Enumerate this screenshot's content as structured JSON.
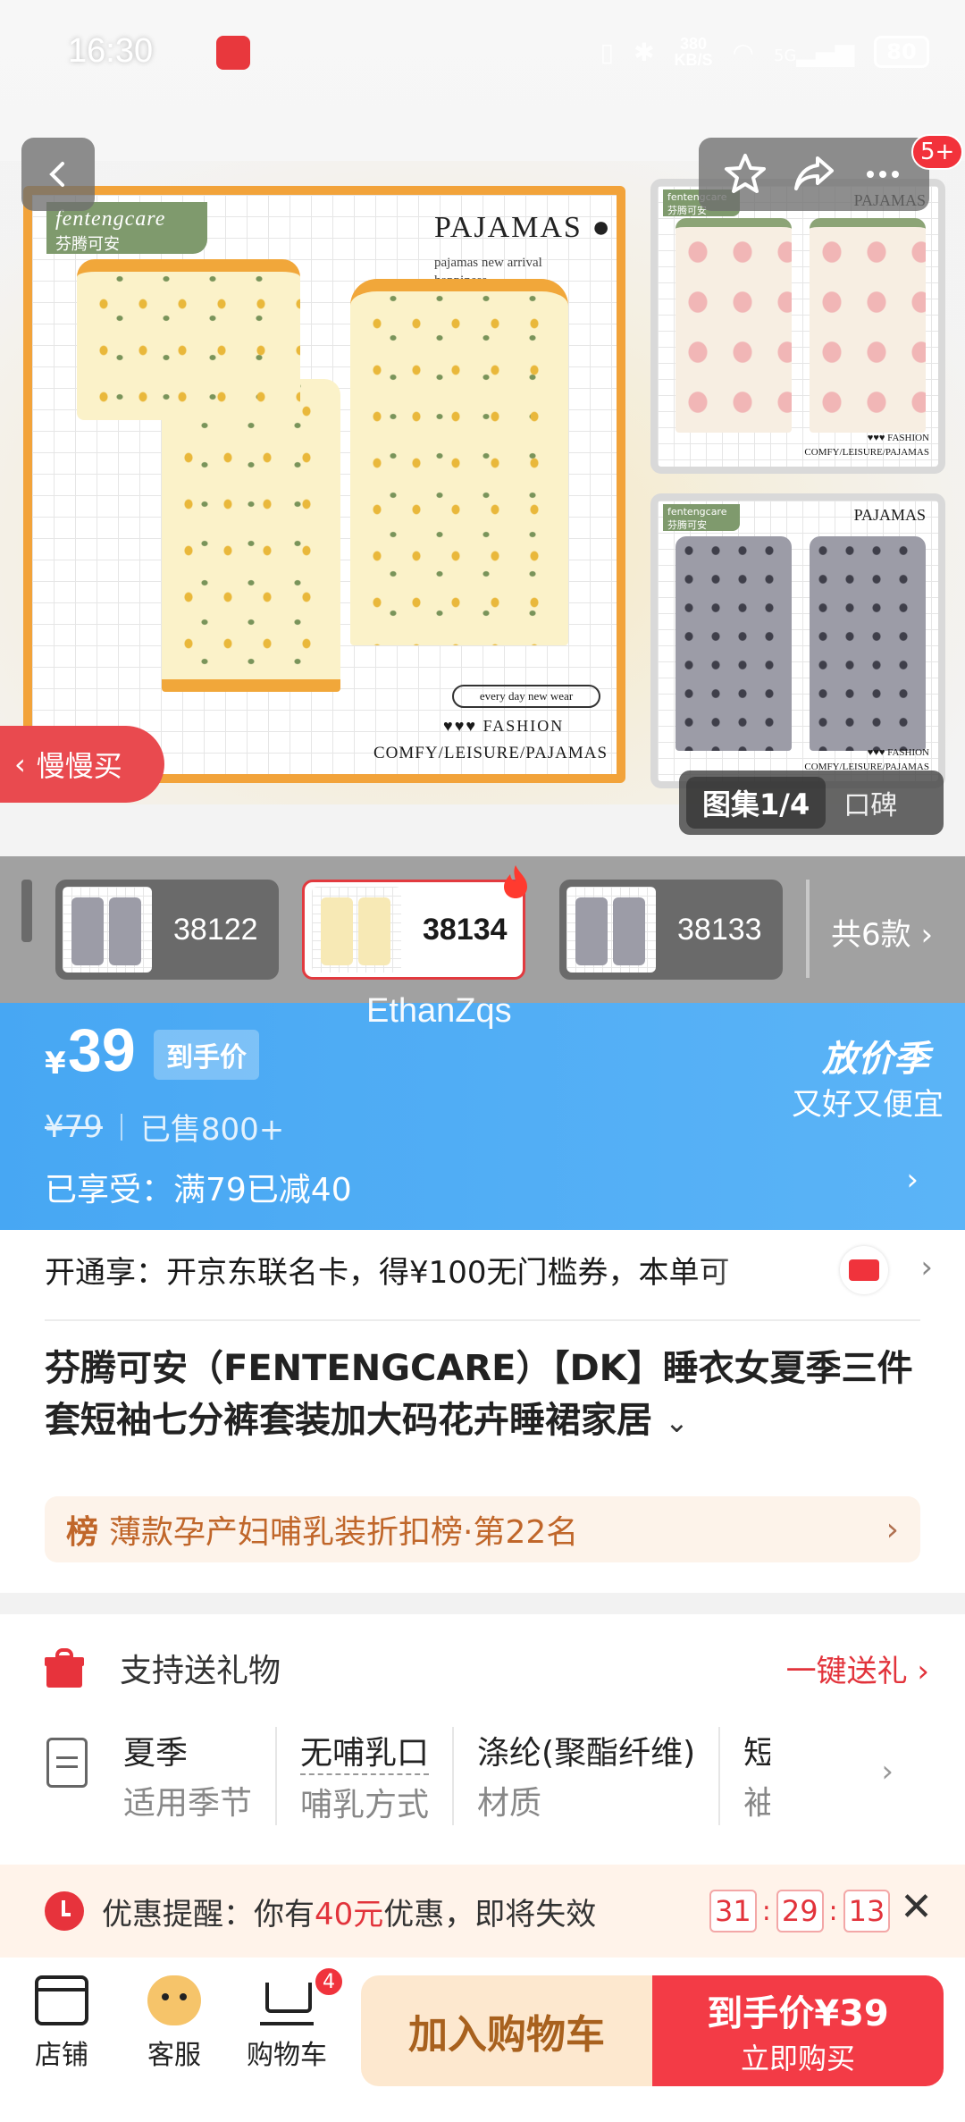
{
  "status_bar": {
    "time": "16:30",
    "net_speed": "380",
    "net_unit": "KB/S",
    "signal": "5G",
    "battery": "80"
  },
  "top_nav": {
    "notification_count": "5+"
  },
  "main_image": {
    "brand_line1": "fentengcare",
    "brand_line2": "芬腾可安",
    "title": "PAJAMAS",
    "subtitle_1": "pajamas new arrival",
    "subtitle_2": "happiness.....",
    "pill_text": "every day new wear",
    "fashion": "♥♥♥  FASHION",
    "comfy": "COMFY/LEISURE/PAJAMAS"
  },
  "side_images": {
    "brand_1": "fentengcare",
    "brand_2": "芬腾可安",
    "title": "PAJAMAS",
    "footer_1": "♥♥♥ FASHION",
    "footer_2": "COMFY/LEISURE/PAJAMAS"
  },
  "slow_buy": "慢慢买",
  "gallery": {
    "active": "图集1/4",
    "other": "口碑"
  },
  "variants": {
    "items": [
      {
        "code": "38122"
      },
      {
        "code": "38134"
      },
      {
        "code": "38133"
      }
    ],
    "more": "共6款"
  },
  "price": {
    "watermark": "EthanZqs",
    "currency": "¥",
    "amount": "39",
    "tag": "到手价",
    "original": "¥79",
    "sold": "已售800+",
    "enjoy": "已享受：满79已减40",
    "season_title": "放价季",
    "season_sub": "又好又便宜"
  },
  "member": {
    "text": "开通享：开京东联名卡，得¥100无门槛券，本单可"
  },
  "product": {
    "title": "芬腾可安（FENTENGCARE）【DK】睡衣女夏季三件套短袖七分裤套装加大码花卉睡裙家居",
    "rank_icon": "榜",
    "rank": "薄款孕产妇哺乳装折扣榜·第22名"
  },
  "gift": {
    "label": "支持送礼物",
    "action": "一键送礼"
  },
  "attributes": [
    {
      "value": "夏季",
      "key": "适用季节"
    },
    {
      "value": "无哺乳口",
      "key": "哺乳方式"
    },
    {
      "value": "涤纶(聚酯纤维)",
      "key": "材质"
    },
    {
      "value": "短",
      "key": "袖"
    }
  ],
  "coupon": {
    "prefix": "优惠提醒：你有",
    "amount": "40元",
    "suffix": "优惠，即将失效",
    "timer_h": "31",
    "timer_m": "29",
    "timer_s": "13"
  },
  "bottom_bar": {
    "shop": "店铺",
    "service": "客服",
    "cart": "购物车",
    "cart_count": "4",
    "add_cart": "加入购物车",
    "buy_price": "到手价¥39",
    "buy_now": "立即购买"
  },
  "colors": {
    "accent_red": "#f33b46",
    "price_blue": "#47a7f3",
    "add_cart_bg": "#fde8cf"
  }
}
